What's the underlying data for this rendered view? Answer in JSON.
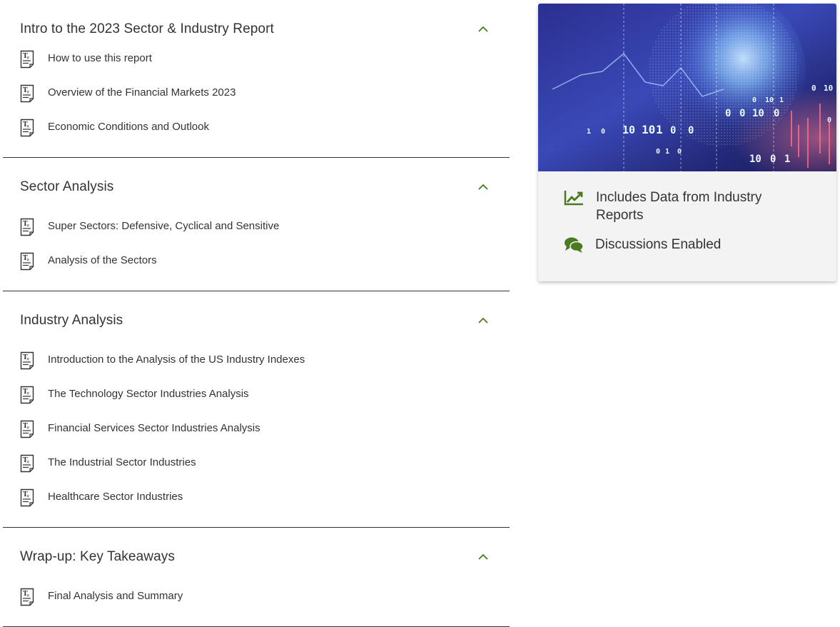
{
  "sections": [
    {
      "title": "Intro to the 2023 Sector & Industry Report",
      "lessons": [
        "How to use this report",
        "Overview of the Financial Markets 2023",
        "Economic Conditions and Outlook"
      ]
    },
    {
      "title": "Sector Analysis",
      "lessons": [
        "Super Sectors: Defensive, Cyclical and Sensitive",
        "Analysis of the Sectors"
      ]
    },
    {
      "title": "Industry Analysis",
      "lessons": [
        "Introduction to the Analysis of the US Industry Indexes",
        "The Technology Sector Industries Analysis",
        "Financial Services Sector Industries Analysis",
        "The Industrial Sector Industries",
        "Healthcare Sector Industries"
      ]
    },
    {
      "title": "Wrap-up: Key Takeaways",
      "lessons": [
        "Final Analysis and Summary"
      ]
    }
  ],
  "lesson_icon": "text-document-icon",
  "section_toggle_icon": "chevron-up-icon",
  "card": {
    "features": [
      {
        "icon": "line-chart-icon",
        "label": "Includes Data from Industry Reports"
      },
      {
        "icon": "chat-bubbles-icon",
        "label": "Discussions Enabled"
      }
    ],
    "banner_digits": [
      "0",
      "10",
      "0",
      "10",
      "1",
      "0",
      "0",
      "10",
      "0",
      "0",
      "10",
      "1",
      "0",
      "0",
      "10",
      "1",
      "0",
      "0",
      "1",
      "0",
      "10",
      "0",
      "1"
    ]
  },
  "colors": {
    "accent_green": "#4a7a1e",
    "divider": "#333333",
    "card_bg": "#f3f3f3"
  }
}
